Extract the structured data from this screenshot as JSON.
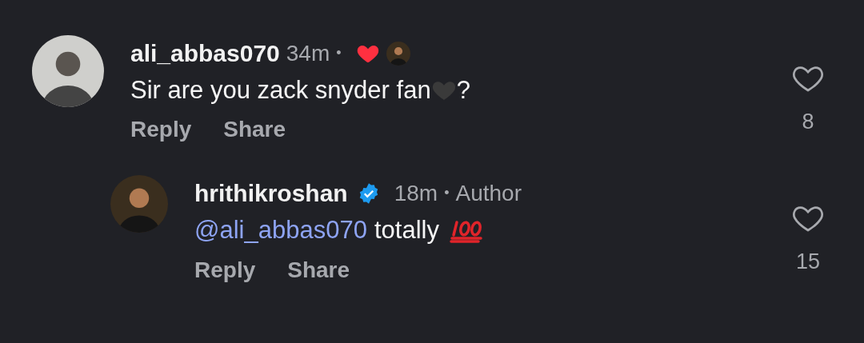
{
  "comments": [
    {
      "username": "ali_abbas070",
      "verified": false,
      "time": "34m",
      "separator": "•",
      "liked_by_author": true,
      "parts": [
        {
          "kind": "text",
          "text": "Sir are you zack snyder fan"
        },
        {
          "kind": "heart"
        },
        {
          "kind": "text",
          "text": "?"
        }
      ],
      "actions": [
        "Reply",
        "Share"
      ],
      "liked": false,
      "like_count": "8",
      "reply": false
    },
    {
      "username": "hrithikroshan",
      "verified": true,
      "time": "18m",
      "separator": "•",
      "author_label": "Author",
      "liked_by_author": false,
      "parts": [
        {
          "kind": "mention",
          "text": "@ali_abbas070"
        },
        {
          "kind": "text",
          "text": "totally"
        },
        {
          "kind": "hundred"
        }
      ],
      "actions": [
        "Reply",
        "Share"
      ],
      "liked": false,
      "like_count": "15",
      "reply": true
    }
  ]
}
